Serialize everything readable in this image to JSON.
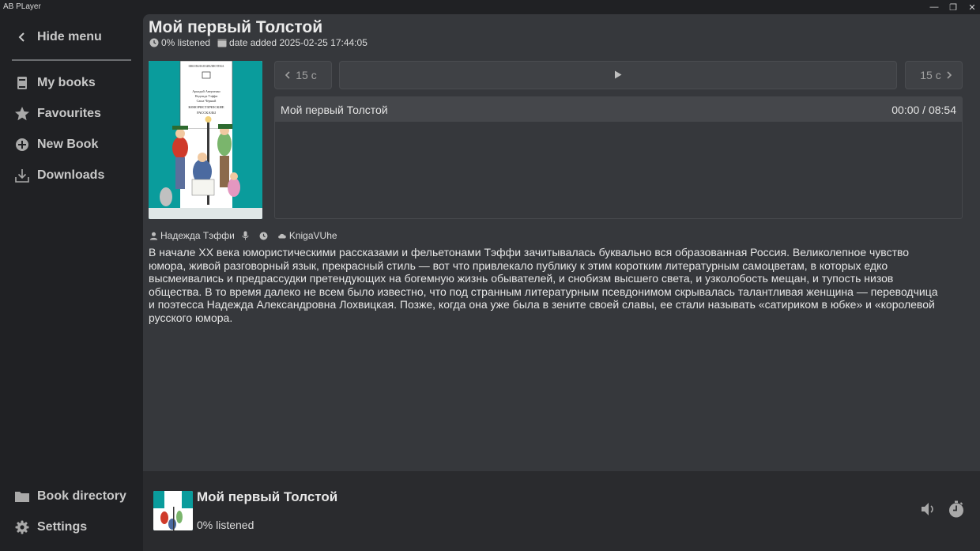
{
  "window": {
    "title": "AB PLayer",
    "controls": {
      "minimize": "—",
      "maximize": "❐",
      "close": "✕"
    }
  },
  "sidebar": {
    "hide_menu": "Hide menu",
    "items": [
      {
        "label": "My books",
        "icon": "book-icon"
      },
      {
        "label": "Favourites",
        "icon": "star-icon"
      },
      {
        "label": "New Book",
        "icon": "plus-circle-icon"
      },
      {
        "label": "Downloads",
        "icon": "download-icon"
      }
    ],
    "bottom_items": [
      {
        "label": "Book directory",
        "icon": "folder-icon"
      },
      {
        "label": "Settings",
        "icon": "gear-icon"
      }
    ]
  },
  "book": {
    "title": "Мой первый Толстой",
    "listened": "0% listened",
    "date_added": "date added 2025-02-25 17:44:05",
    "author": "Надежда Тэффи",
    "source": "KnigaVUhe",
    "description": "В начале XX века юмористическими рассказами и фельетонами Тэффи зачитывалась буквально вся образованная Россия. Великолепное чувство юмора, живой разговорный язык, прекрасный стиль — вот что привлекало публику к этим коротким литературным самоцветам, в которых едко высмеивались и предрассудки претендующих на богемную жизнь обывателей, и снобизм высшего света, и узколобость мещан, и тупость низов общества. В то время далеко не всем было известно, что под странным литературным псевдонимом скрывалась талантливая женщина — переводчица и поэтесса Надежда Александровна Лохвицкая. Позже, когда она уже была в зените своей славы, ее стали называть «сатириком в юбке» и «королевой русского юмора.",
    "cover": {
      "series": "ШКОЛЬНАЯ БИБЛИОТЕКА",
      "authors": [
        "Аркадий Аверченко",
        "Надежда Тэффи",
        "Саша Чёрный"
      ],
      "title_lines": [
        "ЮМОРИСТИЧЕСКИЕ",
        "РАССКАЗЫ"
      ],
      "accent": "#0a9c9c"
    }
  },
  "player": {
    "back_label": "15 с",
    "forward_label": "15 с",
    "chapters": [
      {
        "title": "Мой первый Толстой",
        "time": "00:00 / 08:54"
      }
    ]
  },
  "now_playing": {
    "title": "Мой первый Толстой",
    "progress": "0% listened"
  },
  "colors": {
    "background": "#202124",
    "panel": "#36383c",
    "player_bar": "#2a2b2e",
    "text": "#e6e6e6"
  }
}
